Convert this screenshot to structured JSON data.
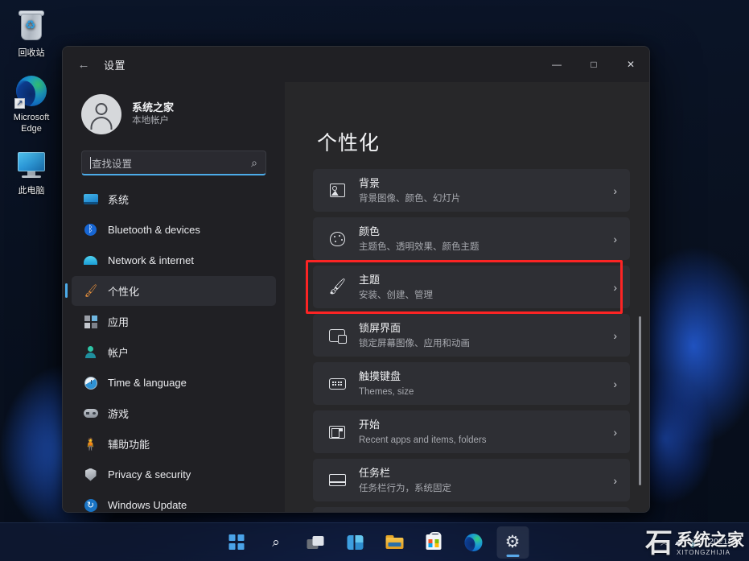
{
  "desktop": {
    "icons": [
      {
        "name": "recycle-bin",
        "label": "回收站"
      },
      {
        "name": "microsoft-edge",
        "label": "Microsoft Edge"
      },
      {
        "name": "this-pc",
        "label": "此电脑"
      }
    ]
  },
  "window": {
    "title": "设置",
    "back_icon": "←",
    "controls": {
      "minimize": "—",
      "maximize": "□",
      "close": "✕"
    }
  },
  "sidebar": {
    "account": {
      "name": "系统之家",
      "type": "本地帐户"
    },
    "search": {
      "placeholder": "查找设置",
      "value": "查找设置",
      "icon": "⌕"
    },
    "items": [
      {
        "label": "系统",
        "icon": "system-icon",
        "selected": false
      },
      {
        "label": "Bluetooth & devices",
        "icon": "bluetooth-icon",
        "selected": false
      },
      {
        "label": "Network & internet",
        "icon": "network-icon",
        "selected": false
      },
      {
        "label": "个性化",
        "icon": "personalization-icon",
        "selected": true
      },
      {
        "label": "应用",
        "icon": "apps-icon",
        "selected": false
      },
      {
        "label": "帐户",
        "icon": "accounts-icon",
        "selected": false
      },
      {
        "label": "Time & language",
        "icon": "time-icon",
        "selected": false
      },
      {
        "label": "游戏",
        "icon": "gaming-icon",
        "selected": false
      },
      {
        "label": "辅助功能",
        "icon": "accessibility-icon",
        "selected": false
      },
      {
        "label": "Privacy & security",
        "icon": "shield-icon",
        "selected": false
      },
      {
        "label": "Windows Update",
        "icon": "update-icon",
        "selected": false
      }
    ]
  },
  "content": {
    "page_title": "个性化",
    "chevron": "›",
    "cards": [
      {
        "title": "背景",
        "subtitle": "背景图像、颜色、幻灯片",
        "icon": "picture-icon",
        "highlighted": false
      },
      {
        "title": "颜色",
        "subtitle": "主题色、透明效果、颜色主题",
        "icon": "palette-icon",
        "highlighted": false
      },
      {
        "title": "主题",
        "subtitle": "安装、创建、管理",
        "icon": "brush-icon",
        "highlighted": true
      },
      {
        "title": "锁屏界面",
        "subtitle": "锁定屏幕图像、应用和动画",
        "icon": "lock-icon",
        "highlighted": false
      },
      {
        "title": "触摸键盘",
        "subtitle": "Themes, size",
        "icon": "keyboard-icon",
        "highlighted": false
      },
      {
        "title": "开始",
        "subtitle": "Recent apps and items, folders",
        "icon": "start-icon",
        "highlighted": false
      },
      {
        "title": "任务栏",
        "subtitle": "任务栏行为，系统固定",
        "icon": "taskbar-icon",
        "highlighted": false
      }
    ],
    "annotation_color": "#fc2424"
  },
  "taskbar": {
    "buttons": [
      {
        "name": "start-button",
        "active": false
      },
      {
        "name": "search-button",
        "active": false
      },
      {
        "name": "task-view-button",
        "active": false
      },
      {
        "name": "widgets-button",
        "active": false
      },
      {
        "name": "file-explorer-button",
        "active": false
      },
      {
        "name": "microsoft-store-button",
        "active": false
      },
      {
        "name": "edge-button",
        "active": false
      },
      {
        "name": "settings-button",
        "active": true
      }
    ],
    "tray": {
      "chevron": "︿",
      "network_icon": "▰",
      "volume_icon": "🔊",
      "date": "2021/7/2"
    }
  },
  "watermark": {
    "mark": "石",
    "title": "系统之家",
    "subtitle": "XITONGZHIJIA"
  },
  "colors": {
    "accent": "#4cabe8",
    "annotation": "#fc2424",
    "window_bg": "#1f1f24",
    "card_bg": "#2e2f34"
  }
}
